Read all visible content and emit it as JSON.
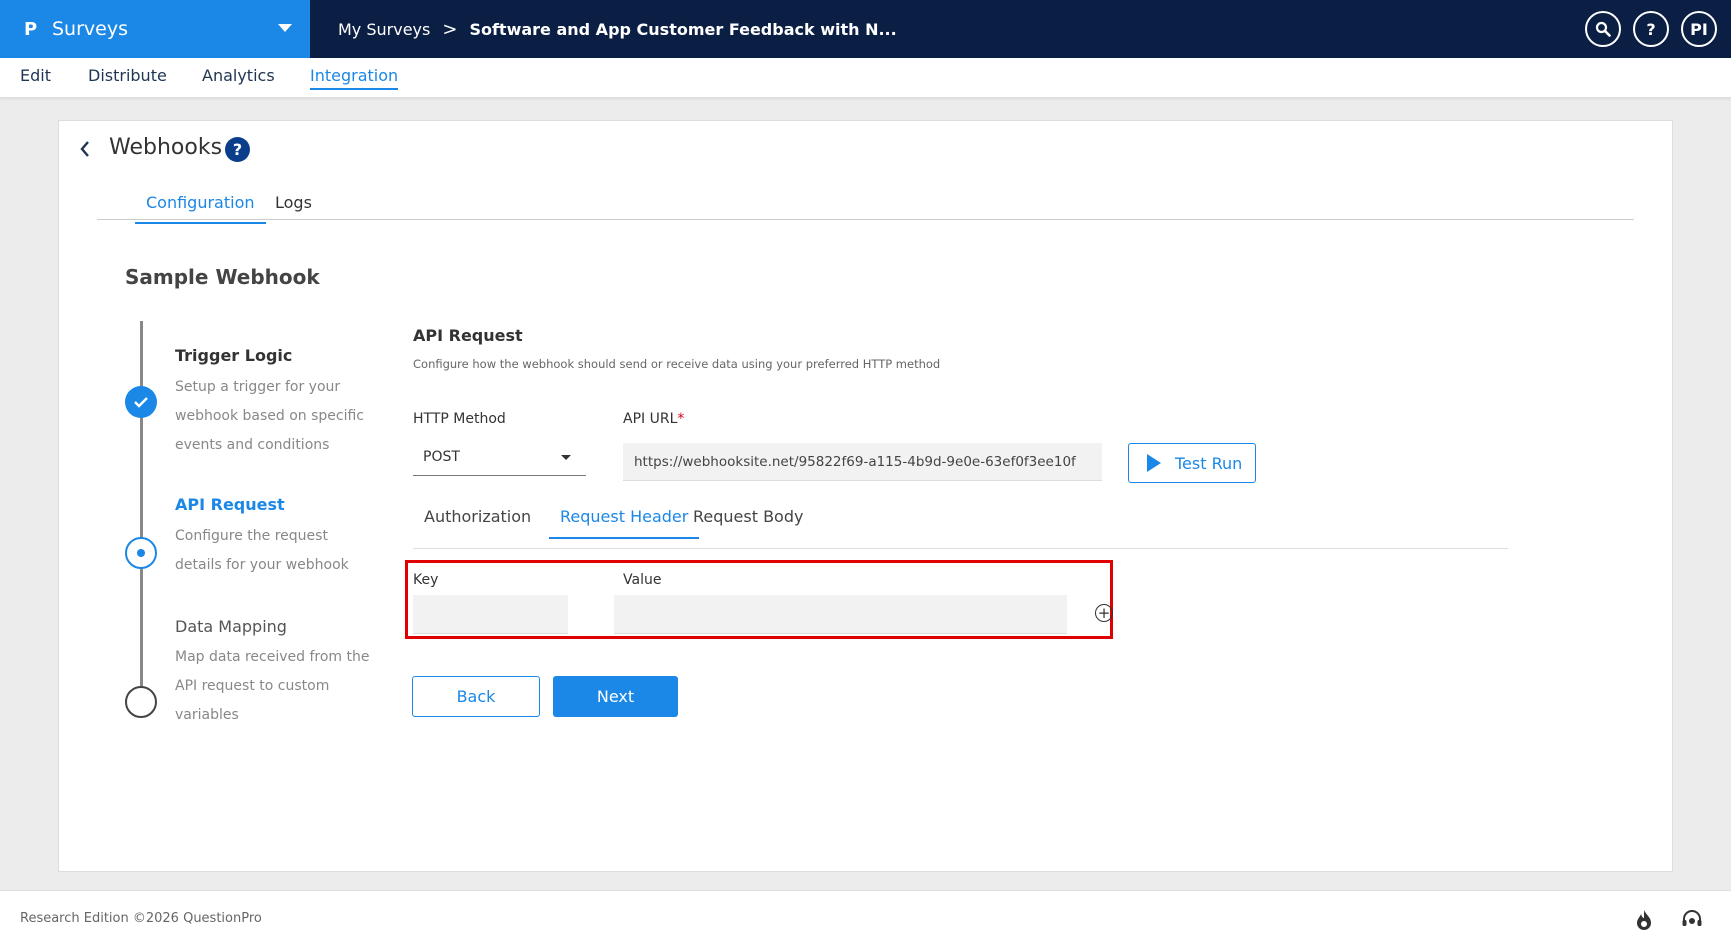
{
  "header": {
    "brand_logo": "P",
    "brand_name": "Surveys",
    "breadcrumb": {
      "parent": "My Surveys",
      "separator": ">",
      "current": "Software and App Customer Feedback with N..."
    },
    "icons": {
      "search": "search-icon",
      "help_label": "?",
      "avatar_initials": "PI"
    }
  },
  "subnav": {
    "items": [
      "Edit",
      "Distribute",
      "Analytics",
      "Integration"
    ],
    "active": "Integration"
  },
  "page": {
    "title": "Webhooks",
    "help_label": "?",
    "tabs": [
      "Configuration",
      "Logs"
    ],
    "active_tab": "Configuration",
    "section_title": "Sample Webhook"
  },
  "stepper": {
    "steps": [
      {
        "title": "Trigger Logic",
        "description": "Setup a trigger for your webhook based on specific events and conditions",
        "state": "done"
      },
      {
        "title": "API Request",
        "description": "Configure the request details for your webhook",
        "state": "current"
      },
      {
        "title": "Data Mapping",
        "description": "Map data received from the API request to custom variables",
        "state": "pending"
      }
    ]
  },
  "form": {
    "title": "API Request",
    "subtitle": "Configure how the webhook should send or receive data using your preferred HTTP method",
    "http_method_label": "HTTP Method",
    "http_method_value": "POST",
    "api_url_label": "API URL",
    "required_mark": "*",
    "api_url_value": "https://webhooksite.net/95822f69-a115-4b9d-9e0e-63ef0f3ee10f",
    "test_run_label": "Test Run",
    "subtabs": [
      "Authorization",
      "Request Header",
      "Request Body"
    ],
    "active_subtab": "Request Header",
    "key_label": "Key",
    "value_label": "Value",
    "key_value": "",
    "value_value": "",
    "add_symbol": "+",
    "back_label": "Back",
    "next_label": "Next"
  },
  "footer": {
    "text": "Research Edition ©2026 QuestionPro"
  },
  "colors": {
    "brand_blue": "#1b87e6",
    "top_bar": "#0b1f44",
    "highlight": "#e00000"
  }
}
